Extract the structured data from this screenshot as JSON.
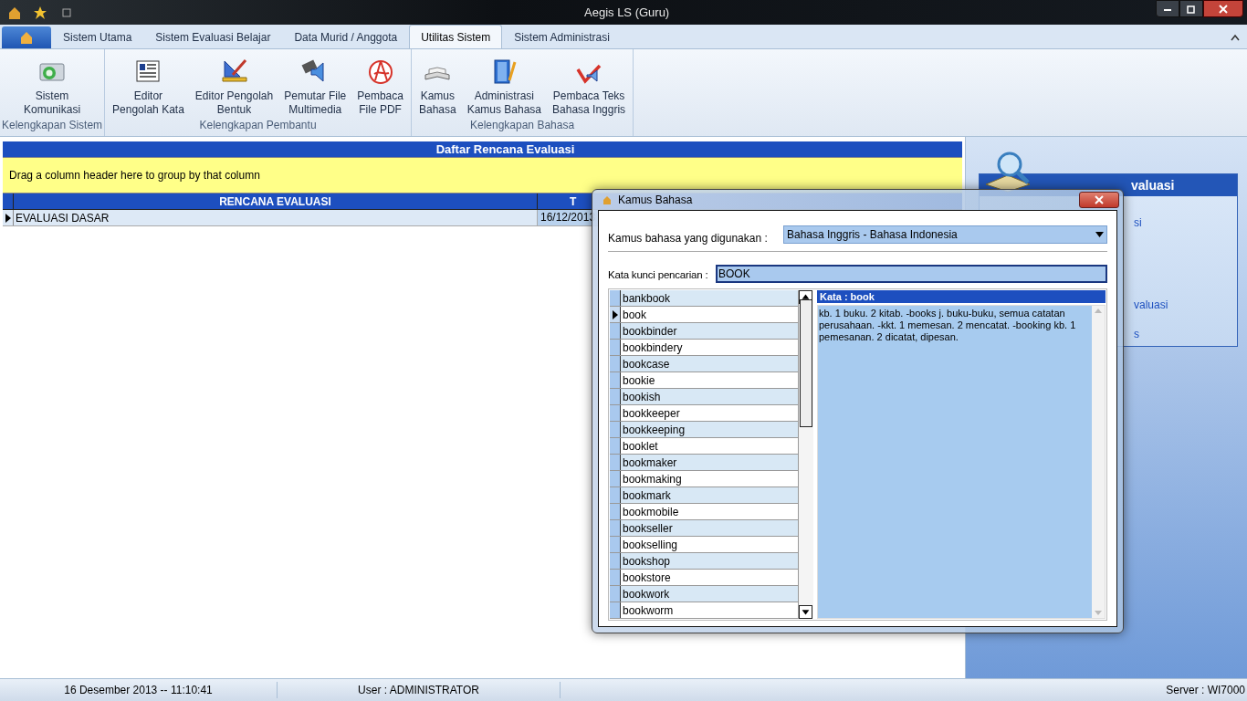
{
  "window": {
    "title": "Aegis LS (Guru)"
  },
  "tabs": [
    {
      "label": "Sistem Utama",
      "selected": false
    },
    {
      "label": "Sistem Evaluasi Belajar",
      "selected": false
    },
    {
      "label": "Data Murid / Anggota",
      "selected": false
    },
    {
      "label": "Utilitas Sistem",
      "selected": true
    },
    {
      "label": "Sistem Administrasi",
      "selected": false
    }
  ],
  "ribbon_groups": [
    {
      "label": "Kelengkapan Sistem",
      "items": [
        {
          "kind": "mail",
          "lines": [
            "Sistem",
            "Komunikasi"
          ]
        }
      ]
    },
    {
      "label": "Kelengkapan Pembantu",
      "items": [
        {
          "kind": "document",
          "lines": [
            "Editor",
            "Pengolah Kata"
          ]
        },
        {
          "kind": "ruler",
          "lines": [
            "Editor Pengolah",
            "Bentuk"
          ]
        },
        {
          "kind": "speaker",
          "lines": [
            "Pemutar File",
            "Multimedia"
          ]
        },
        {
          "kind": "pdf",
          "lines": [
            "Pembaca",
            "File PDF"
          ]
        }
      ]
    },
    {
      "label": "Kelengkapan Bahasa",
      "items": [
        {
          "kind": "book",
          "lines": [
            "Kamus",
            "Bahasa"
          ]
        },
        {
          "kind": "binder",
          "lines": [
            "Administrasi",
            "Kamus Bahasa"
          ]
        },
        {
          "kind": "abc",
          "lines": [
            "Pembaca Teks",
            "Bahasa Inggris"
          ]
        }
      ]
    }
  ],
  "grid": {
    "title": "Daftar Rencana Evaluasi",
    "group_hint": "Drag a column header here to group by that column",
    "columns": [
      "RENCANA EVALUASI",
      "T"
    ],
    "rows": [
      {
        "cells": [
          "EVALUASI DASAR",
          "16/12/2013"
        ],
        "selected": true
      }
    ]
  },
  "side_panel": {
    "title": "valuasi",
    "items": [
      "si",
      "valuasi",
      "s"
    ]
  },
  "dialog": {
    "title": "Kamus Bahasa",
    "dictionary_label": "Kamus bahasa yang digunakan :",
    "dictionary_value": "Bahasa Inggris - Bahasa Indonesia",
    "search_label": "Kata kunci pencarian :",
    "search_value": "BOOK",
    "words": [
      {
        "text": "bankbook",
        "selected": false
      },
      {
        "text": "book",
        "selected": true
      },
      {
        "text": "bookbinder",
        "selected": false
      },
      {
        "text": "bookbindery",
        "selected": false
      },
      {
        "text": "bookcase",
        "selected": false
      },
      {
        "text": "bookie",
        "selected": false
      },
      {
        "text": "bookish",
        "selected": false
      },
      {
        "text": "bookkeeper",
        "selected": false
      },
      {
        "text": "bookkeeping",
        "selected": false
      },
      {
        "text": "booklet",
        "selected": false
      },
      {
        "text": "bookmaker",
        "selected": false
      },
      {
        "text": "bookmaking",
        "selected": false
      },
      {
        "text": "bookmark",
        "selected": false
      },
      {
        "text": "bookmobile",
        "selected": false
      },
      {
        "text": "bookseller",
        "selected": false
      },
      {
        "text": "bookselling",
        "selected": false
      },
      {
        "text": "bookshop",
        "selected": false
      },
      {
        "text": "bookstore",
        "selected": false
      },
      {
        "text": "bookwork",
        "selected": false
      },
      {
        "text": "bookworm",
        "selected": false
      }
    ],
    "definition_title": "Kata : book",
    "definition": "kb. 1 buku. 2 kitab.  -books j. buku-buku, semua catatan perusahaan. -kkt. 1 memesan. 2 mencatat. -booking kb. 1 pemesanan. 2  dicatat, dipesan."
  },
  "status_bar": [
    "16 Desember 2013 -- 11:10:41",
    "User : ADMINISTRATOR",
    "Server : WI7000"
  ]
}
